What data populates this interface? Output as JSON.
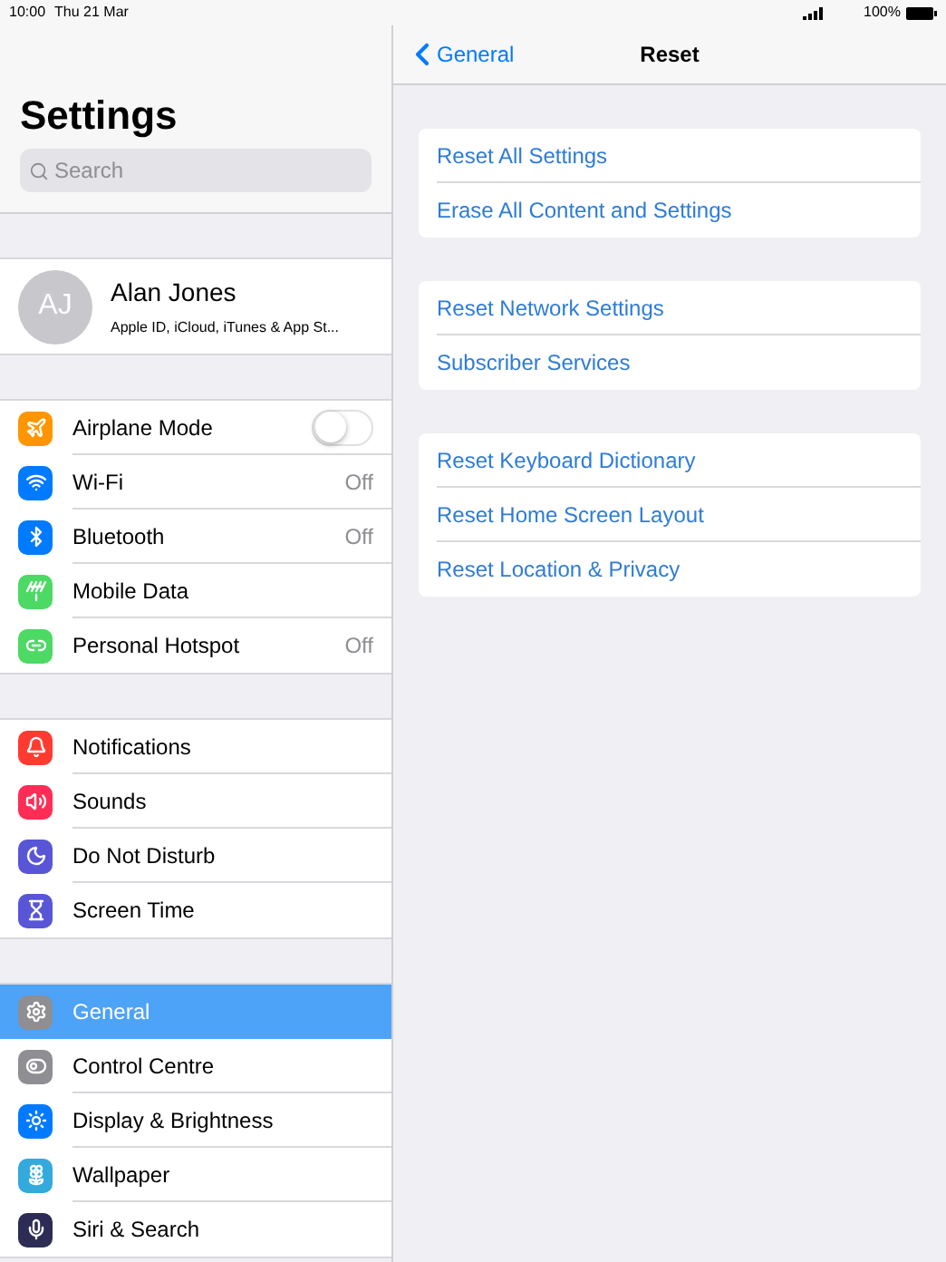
{
  "status_bar": {
    "time": "10:00",
    "date": "Thu 21 Mar",
    "battery": "100%"
  },
  "sidebar": {
    "title": "Settings",
    "search": {
      "placeholder": "Search"
    },
    "profile": {
      "initials": "AJ",
      "name": "Alan Jones",
      "subtitle": "Apple ID, iCloud, iTunes & App St..."
    },
    "groups": [
      [
        {
          "label": "Airplane Mode",
          "color": "#ff9500",
          "kind": "toggle",
          "on": false,
          "selected": false
        },
        {
          "label": "Wi-Fi",
          "color": "#007aff",
          "kind": "value",
          "value": "Off",
          "selected": false
        },
        {
          "label": "Bluetooth",
          "color": "#007aff",
          "kind": "value",
          "value": "Off",
          "selected": false
        },
        {
          "label": "Mobile Data",
          "color": "#4cd964",
          "kind": "plain",
          "selected": false
        },
        {
          "label": "Personal Hotspot",
          "color": "#4cd964",
          "kind": "value",
          "value": "Off",
          "selected": false
        }
      ],
      [
        {
          "label": "Notifications",
          "color": "#ff3b30",
          "kind": "plain",
          "selected": false
        },
        {
          "label": "Sounds",
          "color": "#ff2d55",
          "kind": "plain",
          "selected": false
        },
        {
          "label": "Do Not Disturb",
          "color": "#5856d6",
          "kind": "plain",
          "selected": false
        },
        {
          "label": "Screen Time",
          "color": "#5856d6",
          "kind": "plain",
          "selected": false
        }
      ],
      [
        {
          "label": "General",
          "color": "#8e8e93",
          "kind": "plain",
          "selected": true
        },
        {
          "label": "Control Centre",
          "color": "#8e8e93",
          "kind": "plain",
          "selected": false
        },
        {
          "label": "Display & Brightness",
          "color": "#007aff",
          "kind": "plain",
          "selected": false
        },
        {
          "label": "Wallpaper",
          "color": "#34aadc",
          "kind": "plain",
          "selected": false
        },
        {
          "label": "Siri & Search",
          "color": "#2c2c54",
          "kind": "plain",
          "selected": false
        }
      ]
    ]
  },
  "detail": {
    "back": "General",
    "title": "Reset",
    "groups": [
      [
        "Reset All Settings",
        "Erase All Content and Settings"
      ],
      [
        "Reset Network Settings",
        "Subscriber Services"
      ],
      [
        "Reset Keyboard Dictionary",
        "Reset Home Screen Layout",
        "Reset Location & Privacy"
      ]
    ]
  }
}
